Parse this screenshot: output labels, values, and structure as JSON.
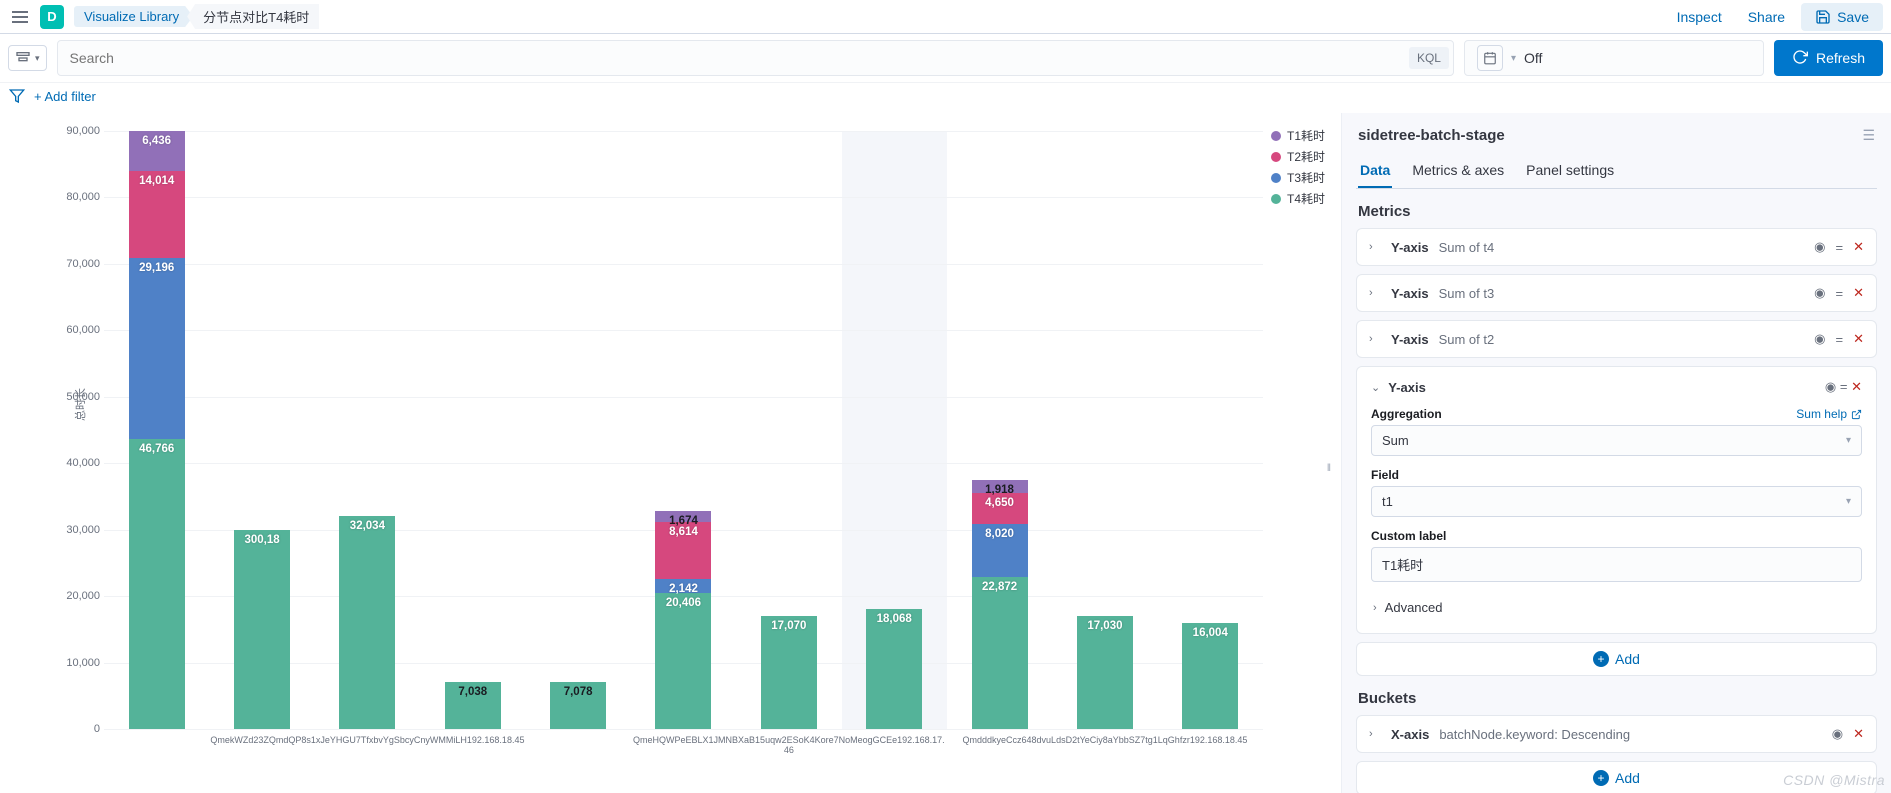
{
  "app_badge": "D",
  "breadcrumb": {
    "library": "Visualize Library",
    "current": "分节点对比T4耗时"
  },
  "top_actions": {
    "inspect": "Inspect",
    "share": "Share",
    "save": "Save"
  },
  "search": {
    "placeholder": "Search",
    "kql": "KQL"
  },
  "datepicker": {
    "value": "Off"
  },
  "refresh": "Refresh",
  "add_filter": "+ Add filter",
  "chart_data": {
    "type": "bar-stacked",
    "ylabel": "总时长",
    "ylim": [
      0,
      90000
    ],
    "yticks": [
      0,
      10000,
      20000,
      30000,
      40000,
      50000,
      60000,
      70000,
      80000,
      90000
    ],
    "ytick_labels": [
      "0",
      "10,000",
      "20,000",
      "30,000",
      "40,000",
      "50,000",
      "60,000",
      "70,000",
      "80,000",
      "90,000"
    ],
    "legend": [
      {
        "name": "T1耗时",
        "color": "#9170b8"
      },
      {
        "name": "T2耗时",
        "color": "#d6487e"
      },
      {
        "name": "T3耗时",
        "color": "#4f81c7"
      },
      {
        "name": "T4耗时",
        "color": "#54b399"
      }
    ],
    "x_groups": [
      "QmekWZd23ZQmdQP8s1xJeYHGU7TfxbvYgSbcyCnyWMMiLH192.168.18.45",
      "QmeHQWPeEBLX1JMNBXaB15uqw2ESoK4Kore7NoMeogGCEe192.168.17.46",
      "QmdddkyeCcz648dvuLdsD2tYeCiy8aYbbSZ7tg1LqGhfzr192.168.18.45"
    ],
    "bars": [
      {
        "segments": [
          {
            "s": "T4",
            "v": 46766,
            "l": "46,766"
          },
          {
            "s": "T3",
            "v": 29196,
            "l": "29,196"
          },
          {
            "s": "T2",
            "v": 14014,
            "l": "14,014"
          },
          {
            "s": "T1",
            "v": 6436,
            "l": "6,436"
          }
        ]
      },
      {
        "segments": [
          {
            "s": "T4",
            "v": 30018,
            "l": "300,18"
          }
        ]
      },
      {
        "segments": [
          {
            "s": "T4",
            "v": 32034,
            "l": "32,034"
          }
        ]
      },
      {
        "segments": [
          {
            "s": "T4",
            "v": 7038,
            "l": "7,038",
            "dark": true
          }
        ]
      },
      {
        "segments": [
          {
            "s": "T4",
            "v": 7078,
            "l": "7,078",
            "dark": true
          }
        ]
      },
      {
        "segments": [
          {
            "s": "T4",
            "v": 20406,
            "l": "20,406"
          },
          {
            "s": "T3",
            "v": 2142,
            "l": "2,142"
          },
          {
            "s": "T2",
            "v": 8614,
            "l": "8,614"
          },
          {
            "s": "T1",
            "v": 1674,
            "l": "1,674",
            "dark": true
          }
        ]
      },
      {
        "segments": [
          {
            "s": "T4",
            "v": 17070,
            "l": "17,070"
          }
        ]
      },
      {
        "segments": [
          {
            "s": "T4",
            "v": 18068,
            "l": "18,068"
          }
        ]
      },
      {
        "segments": [
          {
            "s": "T4",
            "v": 22872,
            "l": "22,872"
          },
          {
            "s": "T3",
            "v": 8020,
            "l": "8,020"
          },
          {
            "s": "T2",
            "v": 4650,
            "l": "4,650"
          },
          {
            "s": "T1",
            "v": 1918,
            "l": "1,918",
            "dark": true
          }
        ]
      },
      {
        "segments": [
          {
            "s": "T4",
            "v": 17030,
            "l": "17,030"
          }
        ]
      },
      {
        "segments": [
          {
            "s": "T4",
            "v": 16004,
            "l": "16,004"
          }
        ]
      }
    ],
    "hover_index": 7
  },
  "panel": {
    "title": "sidetree-batch-stage",
    "tabs": {
      "data": "Data",
      "metrics_axes": "Metrics & axes",
      "panel_settings": "Panel settings"
    },
    "metrics_h": "Metrics",
    "metrics": [
      {
        "axis": "Y-axis",
        "val": "Sum of t4"
      },
      {
        "axis": "Y-axis",
        "val": "Sum of t3"
      },
      {
        "axis": "Y-axis",
        "val": "Sum of t2"
      }
    ],
    "open_metric": {
      "axis": "Y-axis",
      "agg_lbl": "Aggregation",
      "agg_help": "Sum help",
      "agg_val": "Sum",
      "field_lbl": "Field",
      "field_val": "t1",
      "custom_lbl": "Custom label",
      "custom_val": "T1耗时",
      "advanced": "Advanced"
    },
    "add": "Add",
    "buckets_h": "Buckets",
    "bucket": {
      "axis": "X-axis",
      "val": "batchNode.keyword: Descending"
    }
  },
  "watermark": "CSDN @Mistra"
}
